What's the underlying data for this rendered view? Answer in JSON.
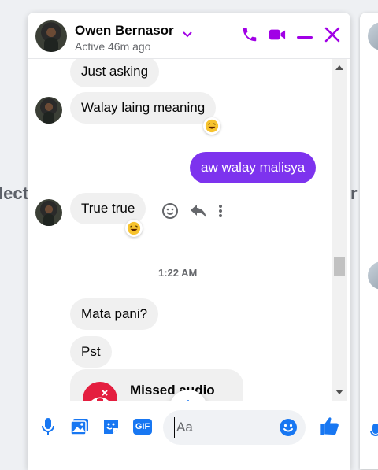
{
  "background": {
    "left_fragment": "lect",
    "right_fragment": "r"
  },
  "header": {
    "name": "Owen Bernasor",
    "status": "Active 46m ago",
    "accent": "#a100e6"
  },
  "messages": {
    "items": [
      {
        "text": "Just asking",
        "from": "them"
      },
      {
        "text": "Walay laing meaning",
        "from": "them",
        "reaction": "laughing"
      },
      {
        "text": "aw walay malisya",
        "from": "me"
      },
      {
        "text": "True true",
        "from": "them",
        "reaction": "laughing"
      }
    ],
    "timestamp": "1:22 AM",
    "later": [
      {
        "text": "Mata pani?",
        "from": "them"
      },
      {
        "text": "Pst",
        "from": "them"
      }
    ],
    "missed_call": "Missed audio"
  },
  "composer": {
    "placeholder": "Aa",
    "gif_label": "GIF"
  },
  "colors": {
    "brand": "#1877f2",
    "my_bubble": "#7d33ee",
    "missed": "#e41e3f"
  }
}
